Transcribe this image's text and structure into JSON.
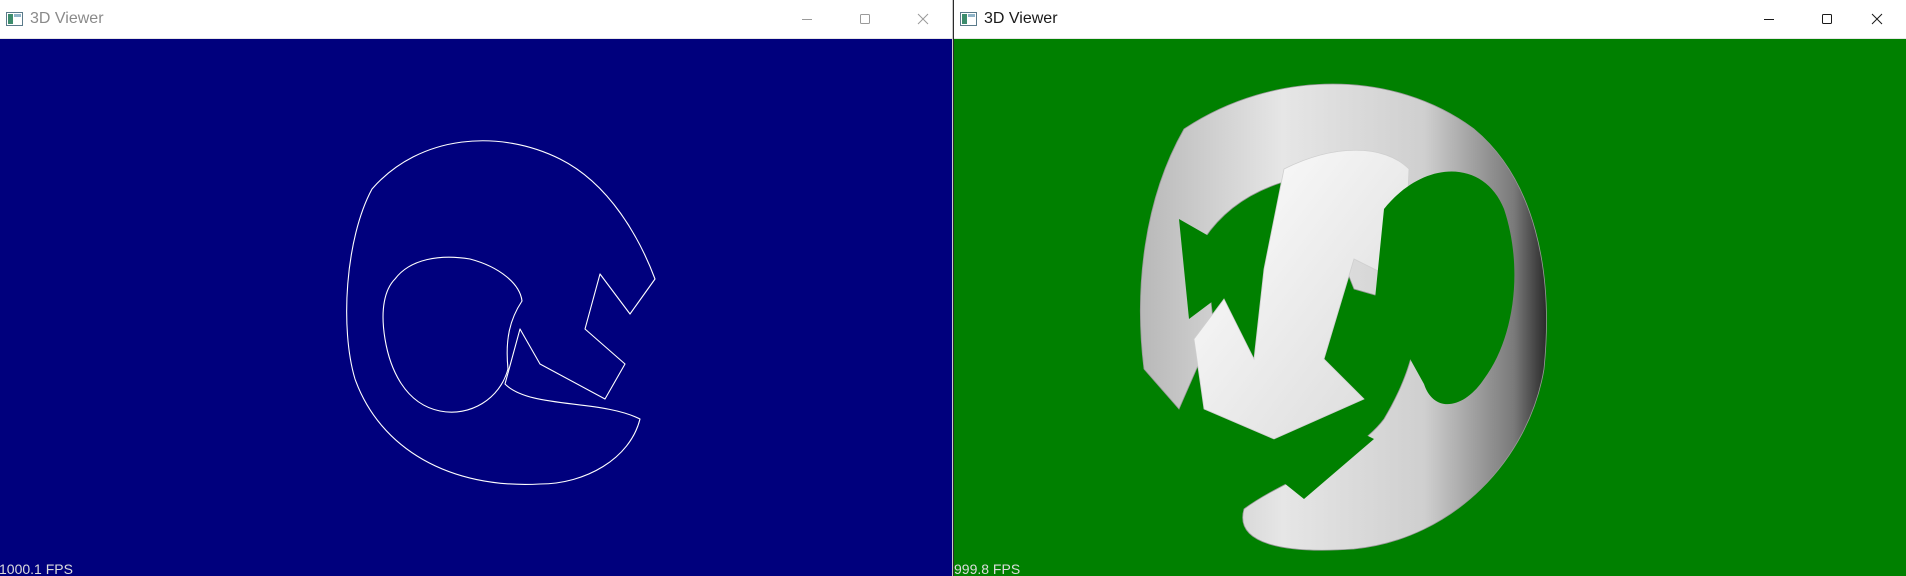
{
  "windows": [
    {
      "title": "3D Viewer",
      "state": "inactive",
      "fps_text": "1000.1 FPS",
      "background_color": "#00007d",
      "render_mode": "wireframe"
    },
    {
      "title": "3D Viewer",
      "state": "active",
      "fps_text": "999.8 FPS",
      "background_color": "#008000",
      "render_mode": "solid-shaded"
    }
  ],
  "icons": {
    "app": "app-window-icon",
    "minimize": "minimize-icon",
    "maximize": "maximize-icon",
    "close": "close-icon"
  },
  "colors": {
    "wireframe": "#ffffff",
    "title_inactive": "#8a8a8a",
    "title_active": "#1a1a1a"
  }
}
